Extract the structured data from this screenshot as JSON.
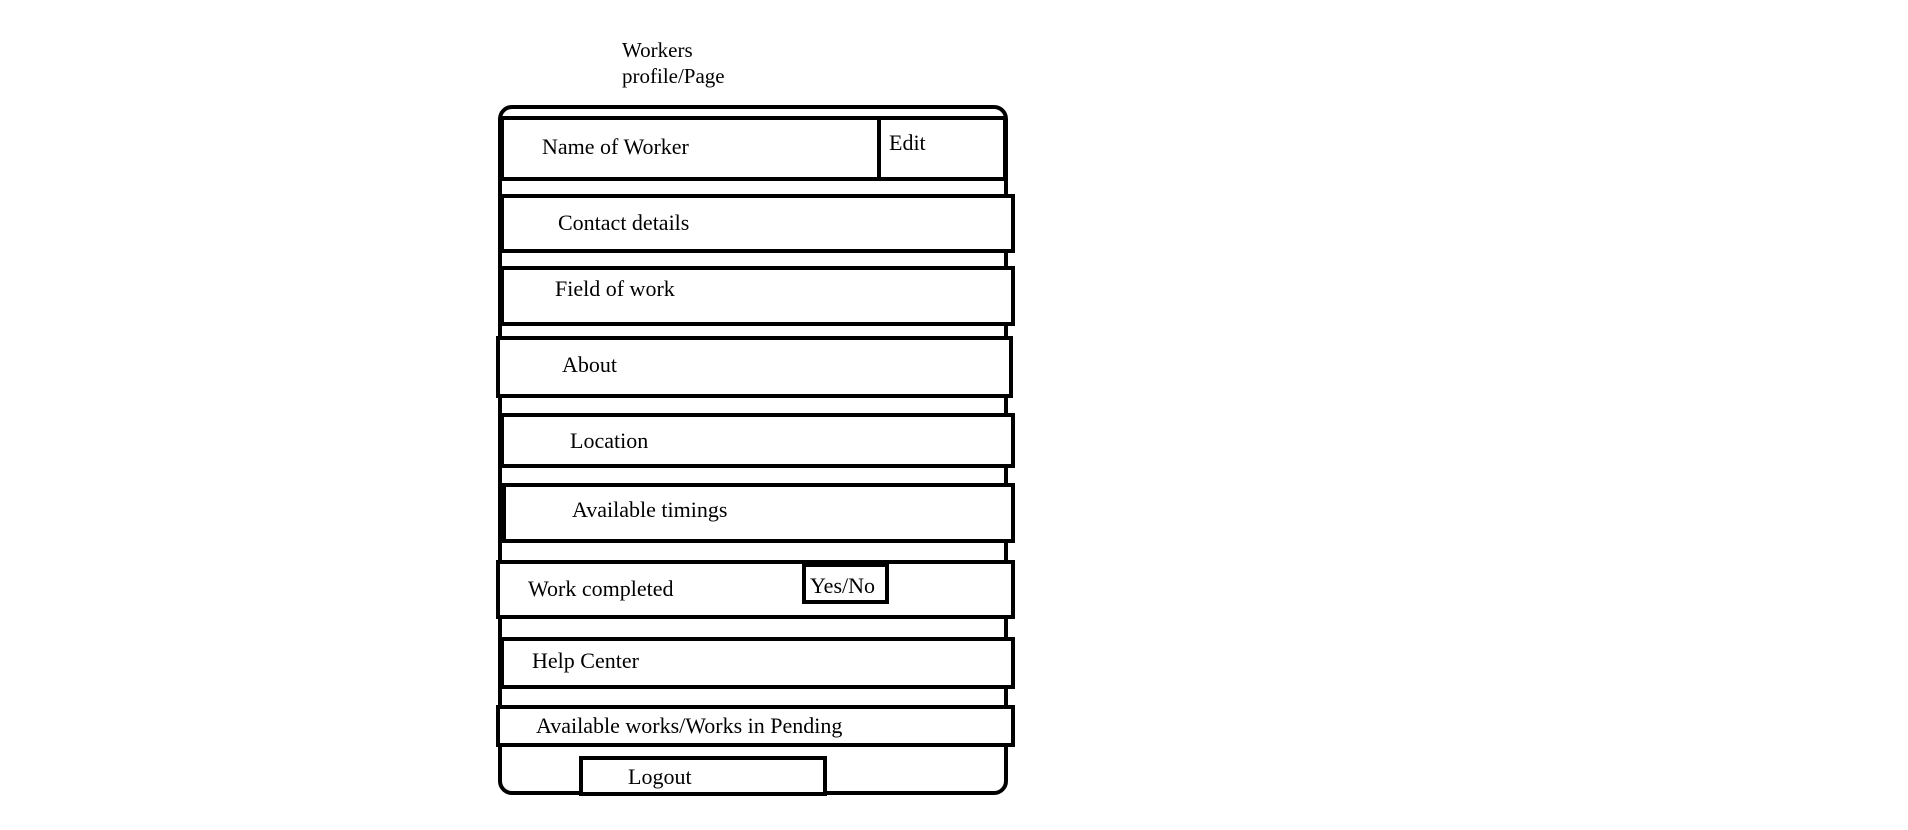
{
  "title": {
    "line1": "Workers",
    "line2": "profile/Page"
  },
  "rows": {
    "name": "Name of Worker",
    "edit": "Edit",
    "contact": "Contact details",
    "field": "Field of work",
    "about": "About",
    "location": "Location",
    "timings": "Available timings",
    "work_completed": "Work completed",
    "yes_no": "Yes/No",
    "help": "Help Center",
    "available_works": "Available works/Works in Pending",
    "logout": "Logout"
  }
}
